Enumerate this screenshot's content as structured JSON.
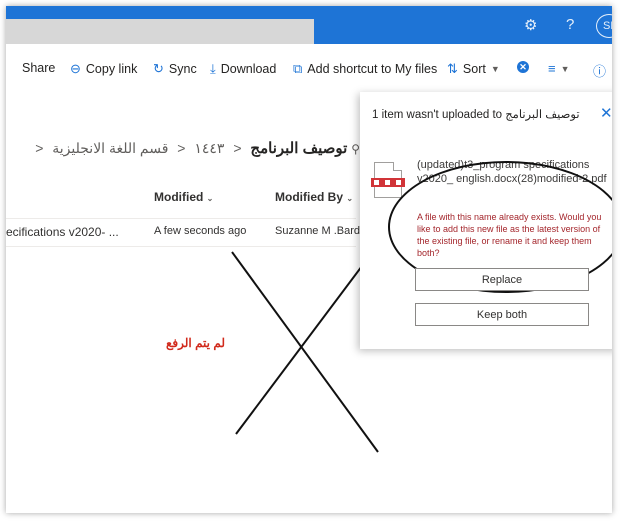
{
  "topbar": {
    "settings_icon": "gear-icon",
    "help_label": "?",
    "avatar_initials": "SB"
  },
  "commands": {
    "share": "Share",
    "copy_link": "Copy link",
    "sync": "Sync",
    "download": "Download",
    "add_shortcut": "Add shortcut to My files",
    "sort": "Sort"
  },
  "breadcrumb": {
    "separator": "<",
    "items": [
      "قسم اللغة الانجليزية",
      "١٤٤٣"
    ],
    "current": "توصيف البرنامج"
  },
  "columns": {
    "modified": "Modified",
    "modified_by": "Modified By"
  },
  "row": {
    "name": "ecifications v2020- ...",
    "modified": "A few seconds ago",
    "modified_by": "Suzanne M .Bardea"
  },
  "annotation": "لم يتم الرفع",
  "panel": {
    "title": "1 item wasn't uploaded to توصيف البرنامج",
    "file_name": "(updated)t3_program specifications v2020_ english.docx(28)modified-2.pdf",
    "message": "A file with this name already exists. Would you like to add this new file as the latest version of the existing file, or rename it and keep them both?",
    "replace_label": "Replace",
    "keep_both_label": "Keep both"
  },
  "colors": {
    "accent": "#1e74d6",
    "warning": "#a4262c",
    "annotation": "#d12a1c"
  }
}
